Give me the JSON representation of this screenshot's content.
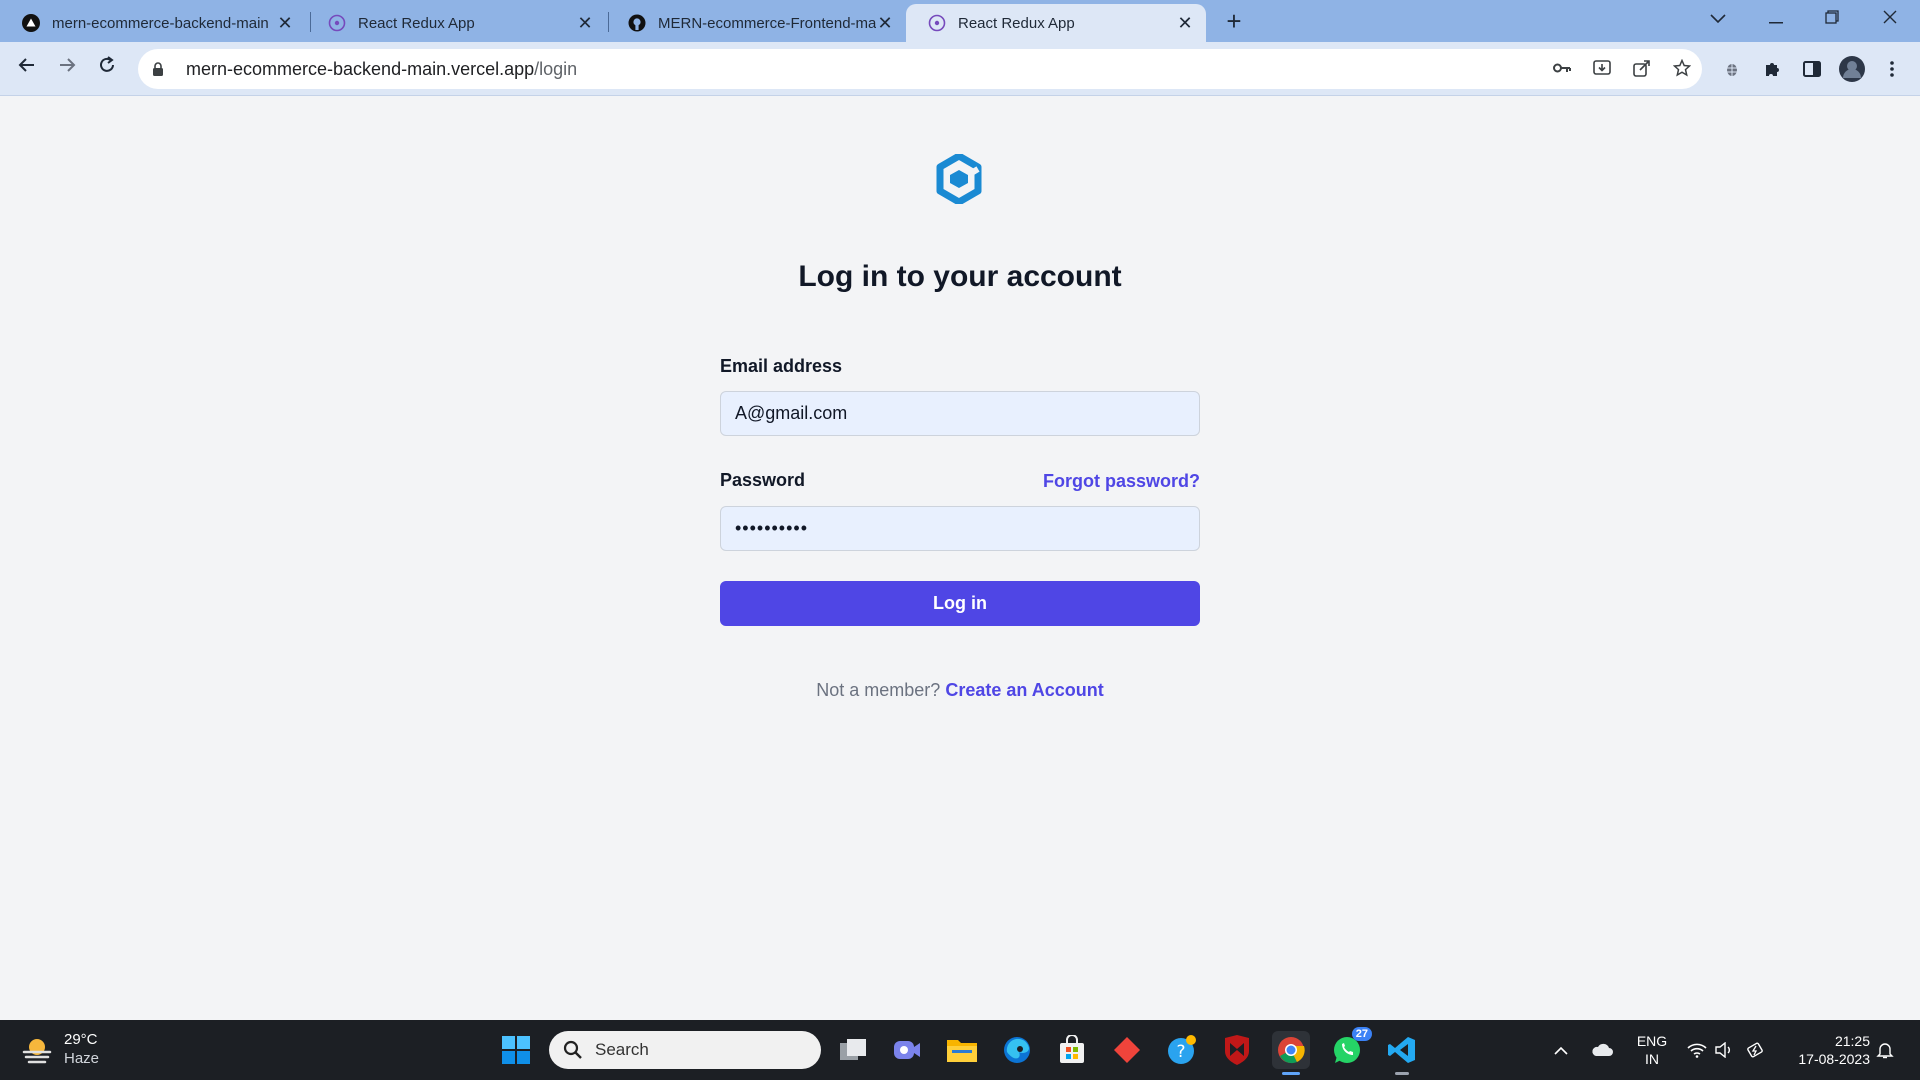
{
  "browser": {
    "tabs": [
      {
        "title": "mern-ecommerce-backend-main",
        "favicon": "vercel-icon",
        "active": false
      },
      {
        "title": "React Redux App",
        "favicon": "react-redux-icon",
        "active": false
      },
      {
        "title": "MERN-ecommerce-Frontend-ma",
        "favicon": "github-icon",
        "active": false
      },
      {
        "title": "React Redux App",
        "favicon": "react-redux-icon",
        "active": true
      }
    ],
    "url_host": "mern-ecommerce-backend-main.vercel.app",
    "url_path": "/login"
  },
  "login": {
    "heading": "Log in to your account",
    "email_label": "Email address",
    "email_value": "A@gmail.com",
    "password_label": "Password",
    "password_value": "••••••••••",
    "forgot_label": "Forgot password?",
    "submit_label": "Log in",
    "not_member": "Not a member?",
    "create_account": "Create an Account",
    "accent_color": "#4f46e5"
  },
  "taskbar": {
    "temperature": "29°C",
    "weather": "Haze",
    "search_placeholder": "Search",
    "whatsapp_badge": "27",
    "lang_line1": "ENG",
    "lang_line2": "IN",
    "time": "21:25",
    "date": "17-08-2023"
  }
}
